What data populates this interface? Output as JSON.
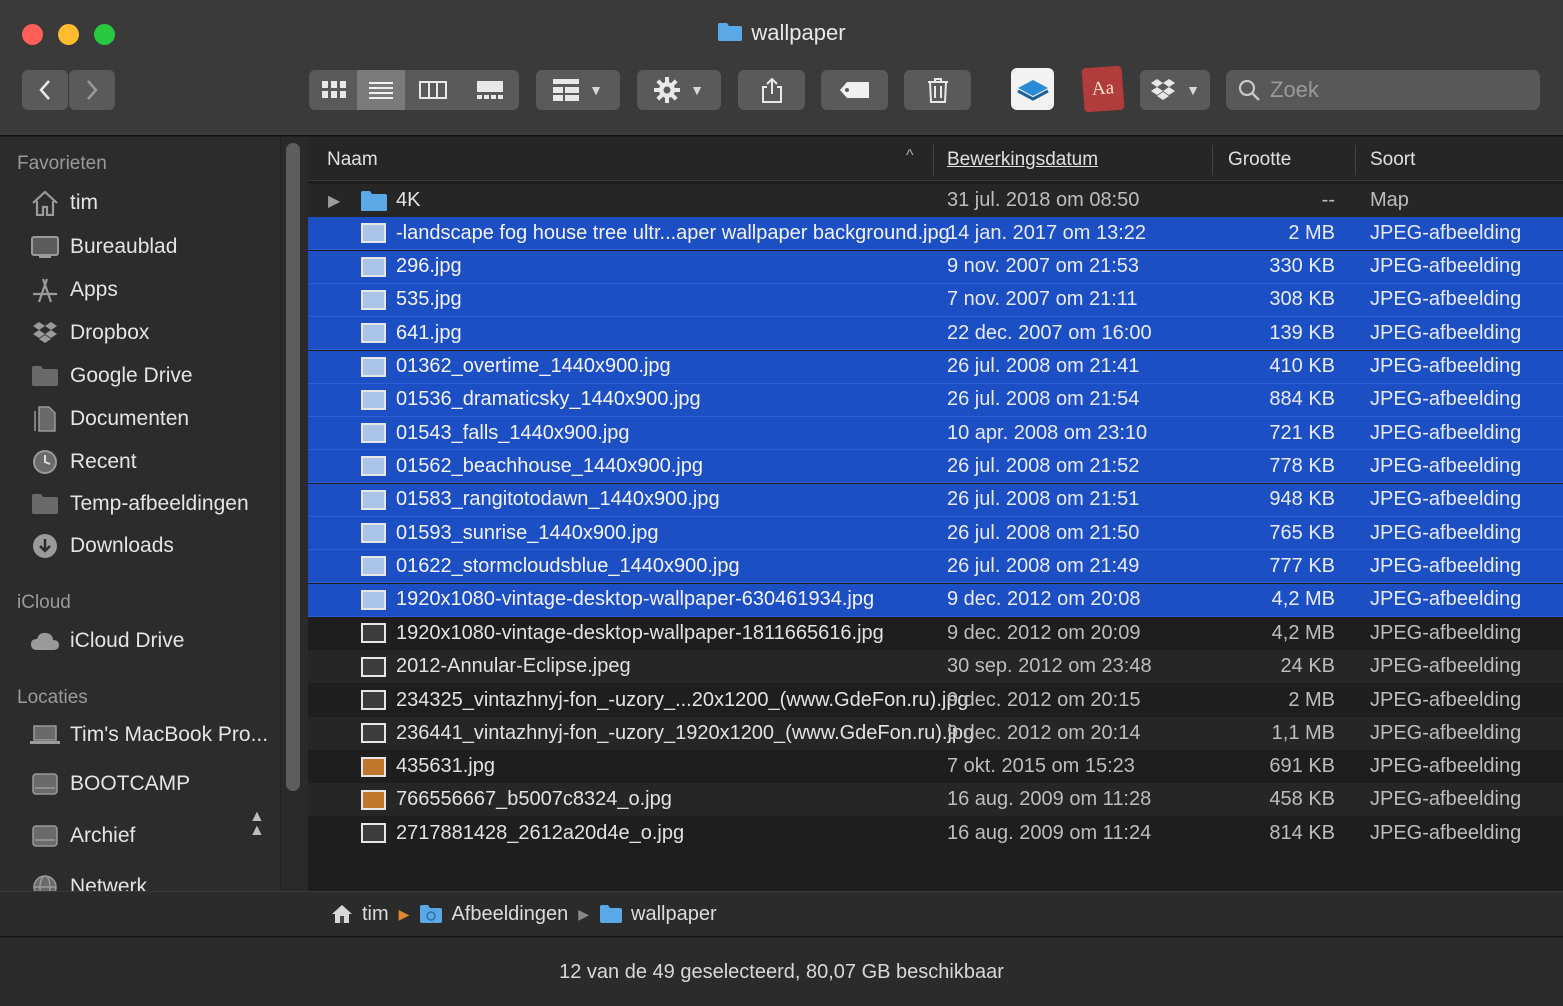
{
  "window": {
    "title": "wallpaper"
  },
  "toolbar": {
    "search_placeholder": "Zoek",
    "icons": [
      "chevron-left-icon",
      "chevron-right-icon",
      "grid-view-icon",
      "list-view-icon",
      "column-view-icon",
      "gallery-view-icon",
      "group-icon",
      "gear-icon",
      "share-icon",
      "tag-icon",
      "trash-icon",
      "layers-app-icon",
      "dictionary-app-icon",
      "dropbox-icon",
      "search-icon"
    ],
    "dictionary_label": "Aa"
  },
  "sidebar": {
    "favorites_header": "Favorieten",
    "favorites": [
      {
        "label": "tim",
        "icon": "home-icon"
      },
      {
        "label": "Bureaublad",
        "icon": "desktop-icon"
      },
      {
        "label": "Apps",
        "icon": "apps-icon"
      },
      {
        "label": "Dropbox",
        "icon": "dropbox-icon"
      },
      {
        "label": "Google Drive",
        "icon": "folder-icon"
      },
      {
        "label": "Documenten",
        "icon": "documents-icon"
      },
      {
        "label": "Recent",
        "icon": "clock-icon"
      },
      {
        "label": "Temp-afbeeldingen",
        "icon": "folder-icon"
      },
      {
        "label": "Downloads",
        "icon": "download-icon"
      }
    ],
    "icloud_header": "iCloud",
    "icloud": [
      {
        "label": "iCloud Drive",
        "icon": "cloud-icon"
      }
    ],
    "locations_header": "Locaties",
    "locations": [
      {
        "label": "Tim's MacBook Pro...",
        "icon": "laptop-icon"
      },
      {
        "label": "BOOTCAMP",
        "icon": "disk-icon"
      },
      {
        "label": "Archief",
        "icon": "disk-icon"
      },
      {
        "label": "Netwerk",
        "icon": "network-icon"
      }
    ]
  },
  "columns": {
    "name": "Naam",
    "date": "Bewerkingsdatum",
    "size": "Grootte",
    "kind": "Soort",
    "sort_indicator": "^"
  },
  "rows": [
    {
      "name": "4K",
      "date": "31 jul. 2018 om 08:50",
      "size": "--",
      "kind": "Map",
      "selected": false,
      "type": "folder"
    },
    {
      "name": "-landscape fog house tree ultr...aper wallpaper background.jpg",
      "date": "14 jan. 2017 om 13:22",
      "size": "2 MB",
      "kind": "JPEG-afbeelding",
      "selected": true
    },
    {
      "name": "296.jpg",
      "date": "9 nov. 2007 om 21:53",
      "size": "330 KB",
      "kind": "JPEG-afbeelding",
      "selected": true
    },
    {
      "name": "535.jpg",
      "date": "7 nov. 2007 om 21:11",
      "size": "308 KB",
      "kind": "JPEG-afbeelding",
      "selected": true
    },
    {
      "name": "641.jpg",
      "date": "22 dec. 2007 om 16:00",
      "size": "139 KB",
      "kind": "JPEG-afbeelding",
      "selected": true
    },
    {
      "name": "01362_overtime_1440x900.jpg",
      "date": "26 jul. 2008 om 21:41",
      "size": "410 KB",
      "kind": "JPEG-afbeelding",
      "selected": true
    },
    {
      "name": "01536_dramaticsky_1440x900.jpg",
      "date": "26 jul. 2008 om 21:54",
      "size": "884 KB",
      "kind": "JPEG-afbeelding",
      "selected": true
    },
    {
      "name": "01543_falls_1440x900.jpg",
      "date": "10 apr. 2008 om 23:10",
      "size": "721 KB",
      "kind": "JPEG-afbeelding",
      "selected": true
    },
    {
      "name": "01562_beachhouse_1440x900.jpg",
      "date": "26 jul. 2008 om 21:52",
      "size": "778 KB",
      "kind": "JPEG-afbeelding",
      "selected": true
    },
    {
      "name": "01583_rangitotodawn_1440x900.jpg",
      "date": "26 jul. 2008 om 21:51",
      "size": "948 KB",
      "kind": "JPEG-afbeelding",
      "selected": true
    },
    {
      "name": "01593_sunrise_1440x900.jpg",
      "date": "26 jul. 2008 om 21:50",
      "size": "765 KB",
      "kind": "JPEG-afbeelding",
      "selected": true
    },
    {
      "name": "01622_stormcloudsblue_1440x900.jpg",
      "date": "26 jul. 2008 om 21:49",
      "size": "777 KB",
      "kind": "JPEG-afbeelding",
      "selected": true
    },
    {
      "name": "1920x1080-vintage-desktop-wallpaper-630461934.jpg",
      "date": "9 dec. 2012 om 20:08",
      "size": "4,2 MB",
      "kind": "JPEG-afbeelding",
      "selected": true
    },
    {
      "name": "1920x1080-vintage-desktop-wallpaper-1811665616.jpg",
      "date": "9 dec. 2012 om 20:09",
      "size": "4,2 MB",
      "kind": "JPEG-afbeelding",
      "selected": false,
      "thumb": "dark"
    },
    {
      "name": "2012-Annular-Eclipse.jpeg",
      "date": "30 sep. 2012 om 23:48",
      "size": "24 KB",
      "kind": "JPEG-afbeelding",
      "selected": false,
      "thumb": "dark"
    },
    {
      "name": "234325_vintazhnyj-fon_-uzory_...20x1200_(www.GdeFon.ru).jpg",
      "date": "9 dec. 2012 om 20:15",
      "size": "2 MB",
      "kind": "JPEG-afbeelding",
      "selected": false,
      "thumb": "dark"
    },
    {
      "name": "236441_vintazhnyj-fon_-uzory_1920x1200_(www.GdeFon.ru).jpg",
      "date": "9 dec. 2012 om 20:14",
      "size": "1,1 MB",
      "kind": "JPEG-afbeelding",
      "selected": false,
      "thumb": "dark"
    },
    {
      "name": "435631.jpg",
      "date": "7 okt. 2015 om 15:23",
      "size": "691 KB",
      "kind": "JPEG-afbeelding",
      "selected": false,
      "thumb": "warm"
    },
    {
      "name": "766556667_b5007c8324_o.jpg",
      "date": "16 aug. 2009 om 11:28",
      "size": "458 KB",
      "kind": "JPEG-afbeelding",
      "selected": false,
      "thumb": "warm"
    },
    {
      "name": "2717881428_2612a20d4e_o.jpg",
      "date": "16 aug. 2009 om 11:24",
      "size": "814 KB",
      "kind": "JPEG-afbeelding",
      "selected": false,
      "thumb": "dark"
    }
  ],
  "pathbar": [
    "tim",
    "Afbeeldingen",
    "wallpaper"
  ],
  "status": "12 van de 49 geselecteerd, 80,07 GB beschikbaar",
  "colors": {
    "selection": "#1d4fc4",
    "folder": "#5aa9e6",
    "path_arrow": "#e0882f"
  }
}
